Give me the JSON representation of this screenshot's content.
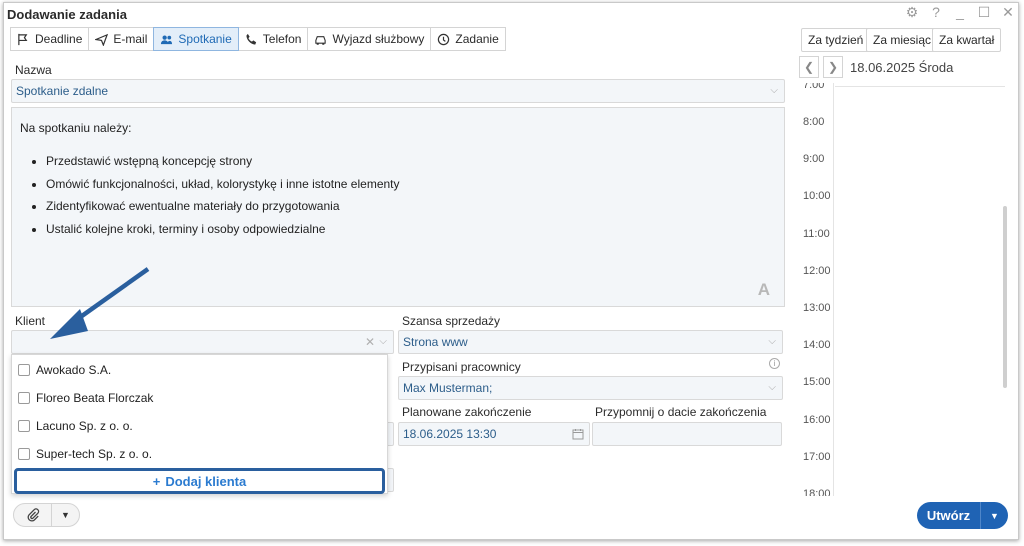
{
  "window": {
    "title": "Dodawanie zadania",
    "controls": [
      "⚙",
      "?",
      "_",
      "☐",
      "✕"
    ]
  },
  "tabs": [
    {
      "label": "Deadline",
      "icon": "flag-icon"
    },
    {
      "label": "E-mail",
      "icon": "paper-plane-icon"
    },
    {
      "label": "Spotkanie",
      "icon": "people-icon",
      "active": true
    },
    {
      "label": "Telefon",
      "icon": "phone-icon"
    },
    {
      "label": "Wyjazd służbowy",
      "icon": "car-icon"
    },
    {
      "label": "Zadanie",
      "icon": "clock-icon"
    }
  ],
  "form": {
    "name_label": "Nazwa",
    "name_value": "Spotkanie zdalne",
    "description": {
      "intro": "Na spotkaniu należy:",
      "bullets": [
        "Przedstawić wstępną koncepcję strony",
        "Omówić funkcjonalności, układ, kolorystykę i inne istotne elementy",
        "Zidentyfikować ewentualne materiały do przygotowania",
        "Ustalić kolejne kroki, terminy i osoby odpowiedzialne"
      ],
      "format_icon": "A"
    },
    "client_label": "Klient",
    "client_value": "",
    "sales_chance_label": "Szansa sprzedaży",
    "sales_chance_value": "Strona www",
    "assigned_label": "Przypisani pracownicy",
    "assigned_value": "Max Musterman;",
    "planned_end_label": "Planowane zakończenie",
    "planned_end_value": "18.06.2025 13:30",
    "remind_label": "Przypomnij o dacie zakończenia",
    "remind_value": ""
  },
  "client_dropdown": {
    "options": [
      "Awokado S.A.",
      "Floreo Beata Florczak",
      "Lacuno Sp. z o. o.",
      "Super-tech Sp. z o. o."
    ],
    "add_label": "Dodaj klienta"
  },
  "calendar": {
    "ranges": [
      "Za tydzień",
      "Za miesiąc",
      "Za kwartał"
    ],
    "date": "18.06.2025 Środa",
    "hours": [
      "7:00",
      "8:00",
      "9:00",
      "10:00",
      "11:00",
      "12:00",
      "13:00",
      "14:00",
      "15:00",
      "16:00",
      "17:00",
      "18:00"
    ]
  },
  "actions": {
    "create_label": "Utwórz"
  },
  "colors": {
    "accent": "#1f63b4",
    "active_tab_bg": "#e3eef9",
    "field_bg": "#f3f6f9",
    "annotation_arrow": "#2a5f9e"
  }
}
